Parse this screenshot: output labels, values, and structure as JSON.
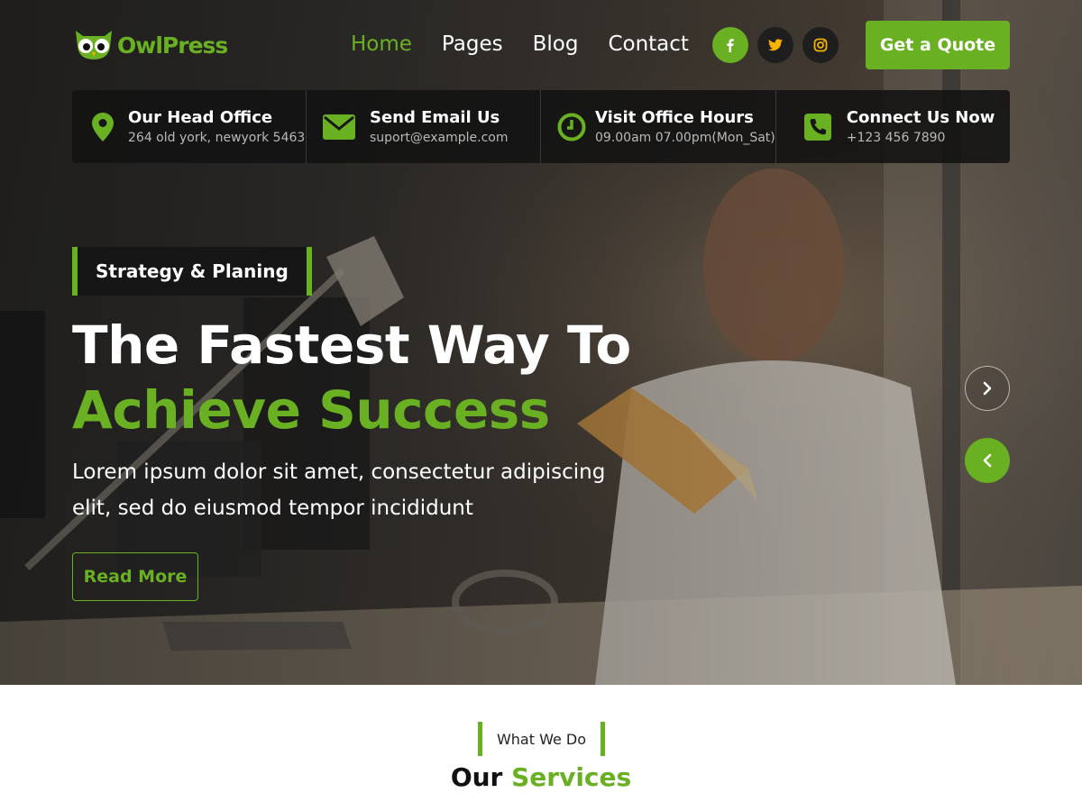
{
  "brand": {
    "name": "OwlPress",
    "accent_color": "#6ab023"
  },
  "nav": {
    "items": [
      {
        "label": "Home",
        "active": true
      },
      {
        "label": "Pages",
        "active": false
      },
      {
        "label": "Blog",
        "active": false
      },
      {
        "label": "Contact",
        "active": false
      }
    ]
  },
  "socials": [
    {
      "icon": "facebook-icon",
      "glyph": "f"
    },
    {
      "icon": "twitter-icon",
      "glyph": "twitter"
    },
    {
      "icon": "instagram-icon",
      "glyph": "instagram"
    }
  ],
  "header": {
    "cta_label": "Get a Quote"
  },
  "info_bar": [
    {
      "icon": "map-pin-icon",
      "title": "Our Head Office",
      "subtitle": "264 old york, newyork 5463"
    },
    {
      "icon": "envelope-icon",
      "title": "Send Email Us",
      "subtitle": "suport@example.com"
    },
    {
      "icon": "clock-icon",
      "title": "Visit Office Hours",
      "subtitle": "09.00am 07.00pm(Mon_Sat)"
    },
    {
      "icon": "phone-icon",
      "title": "Connect Us Now",
      "subtitle": "+123 456 7890"
    }
  ],
  "hero": {
    "tag": "Strategy & Planing",
    "headline_line1": "The Fastest Way To",
    "headline_line2": "Achieve Success",
    "lead_line1": "Lorem ipsum dolor sit amet, consectetur adipiscing",
    "lead_line2": "elit, sed do eiusmod tempor incididunt",
    "button_label": "Read More"
  },
  "services": {
    "tag": "What We Do",
    "title_part1": "Our",
    "title_part2": "Services"
  }
}
